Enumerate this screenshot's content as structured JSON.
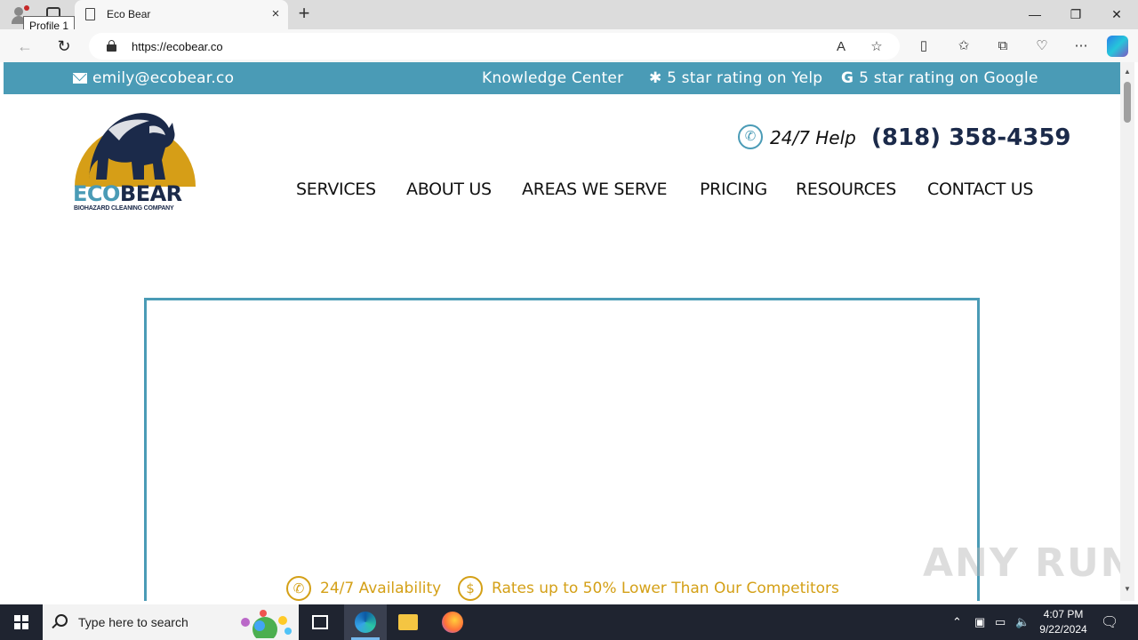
{
  "browser": {
    "tab_title": "Eco Bear",
    "tooltip": "Profile 1",
    "url": "https://ecobear.co",
    "new_tab_glyph": "+",
    "close_glyph": "×"
  },
  "site": {
    "email": "emily@ecobear.co",
    "knowledge_center": "Knowledge Center",
    "yelp_rating": "5 star rating on Yelp",
    "google_rating": "5 star rating on Google",
    "google_glyph": "G",
    "logo_eco": "ECO",
    "logo_bear": "BEAR",
    "logo_tagline": "BIOHAZARD CLEANING COMPANY",
    "help_text": "24/7 Help",
    "phone": "(818) 358-4359",
    "nav": [
      "SERVICES",
      "ABOUT US",
      "AREAS WE SERVE",
      "PRICING",
      "RESOURCES",
      "CONTACT US"
    ],
    "features": [
      {
        "icon": "phone-icon",
        "text": "24/7 Availability"
      },
      {
        "icon": "dollar-icon",
        "text": "Rates up to 50% Lower Than Our Competitors"
      }
    ],
    "watermark": "ANY RUN"
  },
  "taskbar": {
    "search_placeholder": "Type here to search",
    "time": "4:07 PM",
    "date": "9/22/2024"
  },
  "colors": {
    "brand_blue": "#4a9bb6",
    "brand_navy": "#1b2a4a",
    "brand_gold": "#d4a017"
  }
}
